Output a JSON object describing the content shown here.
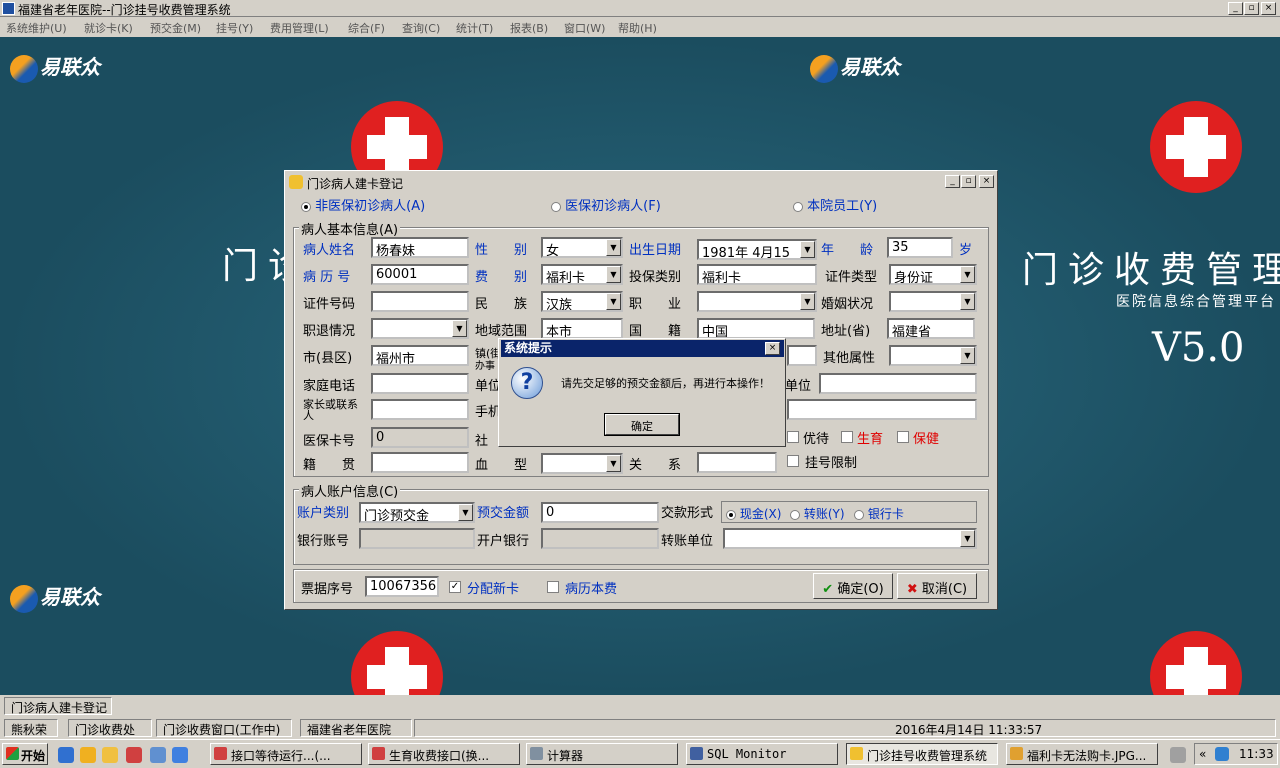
{
  "window": {
    "title": "福建省老年医院--门诊挂号收费管理系统",
    "min": "_",
    "max": "▫",
    "close": "×"
  },
  "menu": [
    "系统维护(U)",
    "就诊卡(K)",
    "预交金(M)",
    "挂号(Y)",
    "费用管理(L)",
    "综合(F)",
    "查询(C)",
    "统计(T)",
    "报表(B)",
    "窗口(W)",
    "帮助(H)"
  ],
  "desktop": {
    "logo": "易联众",
    "big_left": "门诊",
    "big_right": "门诊收费管理",
    "subtitle": "医院信息综合管理平台",
    "version": "V5.0"
  },
  "form": {
    "title": "门诊病人建卡登记",
    "patient_types": {
      "t1": "非医保初诊病人(A)",
      "t2": "医保初诊病人(F)",
      "t3": "本院员工(Y)",
      "selected": "非医保初诊病人(A)"
    },
    "basic_group": "病人基本信息(A)",
    "name_label": "病人姓名",
    "name": "杨春妹",
    "sex_label": "性　　别",
    "sex": "女",
    "dob_label": "出生日期",
    "dob": "1981年 4月15",
    "age_label": "年　　龄",
    "age": "35",
    "age_unit": "岁",
    "record_label": "病 历 号",
    "record": "60001",
    "fee_label": "费　　别",
    "fee": "福利卡",
    "ins_type_label": "投保类别",
    "ins_type": "福利卡",
    "id_type_label": "证件类型",
    "id_type": "身份证",
    "id_no_label": "证件号码",
    "id_no": "",
    "ethnic_label": "民　　族",
    "ethnic": "汉族",
    "job_label": "职　　业",
    "job": "",
    "marital_label": "婚姻状况",
    "marital": "",
    "retire_label": "职退情况",
    "retire": "",
    "region_label": "地域范围",
    "region": "本市",
    "nation_label": "国　　籍",
    "nation": "中国",
    "province_label": "地址(省)",
    "province": "福建省",
    "city_label": "市(县区)",
    "city": "福州市",
    "town_label": "镇(街)",
    "office_label": "办事",
    "other_attr_label": "其他属性",
    "other_attr": "",
    "home_phone_label": "家庭电话",
    "home_phone": "",
    "unit_label": "单位",
    "unit_label2": "单位",
    "unit": "",
    "contact_label": "家长或联系人",
    "contact": "",
    "mobile_label": "手机",
    "mobile": "",
    "ins_card_label": "医保卡号",
    "ins_card": "0",
    "social_label": "社",
    "youdai": "优待",
    "shengyu": "生育",
    "baojian": "保健",
    "native_label": "籍　　贯",
    "native": "",
    "blood_label": "血　　型",
    "blood": "",
    "relation_label": "关　　系",
    "relation": "",
    "reg_limit": "挂号限制",
    "account_group": "病人账户信息(C)",
    "acct_type_label": "账户类别",
    "acct_type": "门诊预交金",
    "prepay_label": "预交金额",
    "prepay": "0",
    "pay_form_label": "交款形式",
    "pay_cash": "现金(X)",
    "pay_transfer": "转账(Y)",
    "pay_bank": "银行卡",
    "bank_acct_label": "银行账号",
    "bank_acct": "",
    "bank_label": "开户银行",
    "bank": "",
    "transfer_unit_label": "转账单位",
    "transfer_unit": "",
    "receipt_label": "票据序号",
    "receipt": "10067356",
    "new_card": "分配新卡",
    "record_fee": "病历本费",
    "ok": "确定(O)",
    "cancel": "取消(C)"
  },
  "dialog": {
    "title": "系统提示",
    "message": "请先交足够的预交金额后，再进行本操作！",
    "ok": "确定",
    "close": "×"
  },
  "status1": {
    "tab": "门诊病人建卡登记"
  },
  "status2": {
    "user": "熊秋荣",
    "dept": "门诊收费处",
    "window": "门诊收费窗口(工作中)",
    "hospital": "福建省老年医院",
    "datetime": "2016年4月14日 11:33:57"
  },
  "taskbar": {
    "start": "开始",
    "items": [
      "接口等待运行...(...",
      "生育收费接口(换...",
      "计算器",
      "SQL Monitor",
      "门诊挂号收费管理系统",
      "福利卡无法购卡.JPG..."
    ],
    "clock": "11:33",
    "chev": "«"
  }
}
